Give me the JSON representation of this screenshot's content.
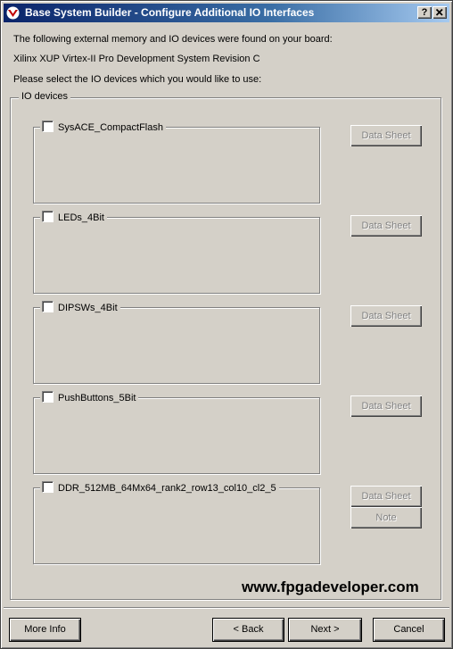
{
  "window": {
    "title": "Base System Builder - Configure Additional IO Interfaces",
    "help_button": "?",
    "close_button": "X"
  },
  "intro": {
    "line1": "The following external memory and IO devices were found on your board:",
    "board": "Xilinx XUP Virtex-II Pro Development System Revision C",
    "line3": "Please select the IO devices which you would like to use:"
  },
  "io_group": {
    "label": "IO devices",
    "devices": [
      {
        "name": "SysACE_CompactFlash",
        "checked": false,
        "datasheet_label": "Data Sheet"
      },
      {
        "name": "LEDs_4Bit",
        "checked": false,
        "datasheet_label": "Data Sheet"
      },
      {
        "name": "DIPSWs_4Bit",
        "checked": false,
        "datasheet_label": "Data Sheet"
      },
      {
        "name": "PushButtons_5Bit",
        "checked": false,
        "datasheet_label": "Data Sheet"
      },
      {
        "name": "DDR_512MB_64Mx64_rank2_row13_col10_cl2_5",
        "checked": false,
        "datasheet_label": "Data Sheet",
        "note_label": "Note"
      }
    ]
  },
  "watermark": "www.fpgadeveloper.com",
  "footer": {
    "more_info": "More Info",
    "back": "< Back",
    "next": "Next >",
    "cancel": "Cancel"
  }
}
